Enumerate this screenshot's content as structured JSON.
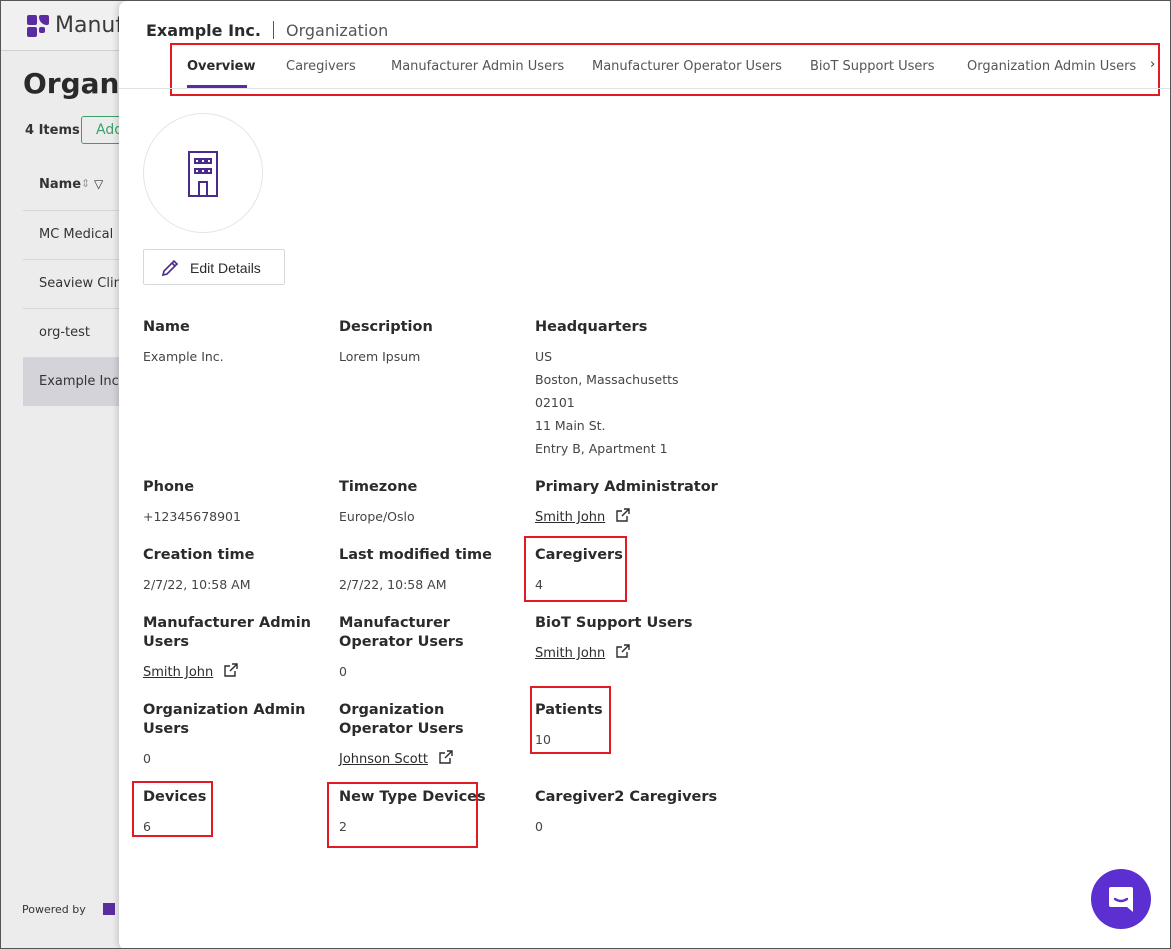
{
  "background": {
    "brand": "Manuf",
    "page_title": "Organiz",
    "items_count": "4 Items",
    "add_button": "Add",
    "column_name": "Name",
    "rows": [
      "MC Medical",
      "Seaview Clinic",
      "org-test",
      "Example Inc."
    ],
    "powered_by": "Powered by"
  },
  "drawer": {
    "entity_name": "Example Inc.",
    "entity_type": "Organization",
    "tabs": [
      {
        "label": "Overview",
        "active": true
      },
      {
        "label": "Caregivers"
      },
      {
        "label": "Manufacturer Admin Users"
      },
      {
        "label": "Manufacturer Operator Users"
      },
      {
        "label": "BioT Support Users"
      },
      {
        "label": "Organization Admin Users"
      }
    ],
    "tabs_more": "›",
    "edit_button": "Edit Details",
    "fields": {
      "name": {
        "label": "Name",
        "value": "Example Inc."
      },
      "description": {
        "label": "Description",
        "value": "Lorem Ipsum"
      },
      "headquarters": {
        "label": "Headquarters",
        "lines": [
          "US",
          "Boston, Massachusetts",
          "02101",
          "11 Main St.",
          "Entry B, Apartment 1"
        ]
      },
      "phone": {
        "label": "Phone",
        "value": "+12345678901"
      },
      "timezone": {
        "label": "Timezone",
        "value": "Europe/Oslo"
      },
      "primary_admin": {
        "label": "Primary Administrator",
        "value": "Smith John"
      },
      "creation_time": {
        "label": "Creation time",
        "value": "2/7/22, 10:58 AM"
      },
      "last_modified": {
        "label": "Last modified time",
        "value": "2/7/22, 10:58 AM"
      },
      "caregivers": {
        "label": "Caregivers",
        "value": "4"
      },
      "mfr_admin": {
        "label": "Manufacturer Admin Users",
        "value": "Smith John"
      },
      "mfr_operator": {
        "label": "Manufacturer Operator Users",
        "value": "0"
      },
      "biot_support": {
        "label": "BioT Support Users",
        "value": "Smith John"
      },
      "org_admin": {
        "label": "Organization Admin Users",
        "value": "0"
      },
      "org_operator": {
        "label": "Organization Operator Users",
        "value": "Johnson Scott"
      },
      "patients": {
        "label": "Patients",
        "value": "10"
      },
      "devices": {
        "label": "Devices",
        "value": "6"
      },
      "new_type_devices": {
        "label": "New Type Devices",
        "value": "2"
      },
      "caregiver2": {
        "label": "Caregiver2 Caregivers",
        "value": "0"
      }
    }
  },
  "colors": {
    "accent": "#5a2ca0",
    "highlight": "#e01b24",
    "chat": "#5b2fd0"
  }
}
